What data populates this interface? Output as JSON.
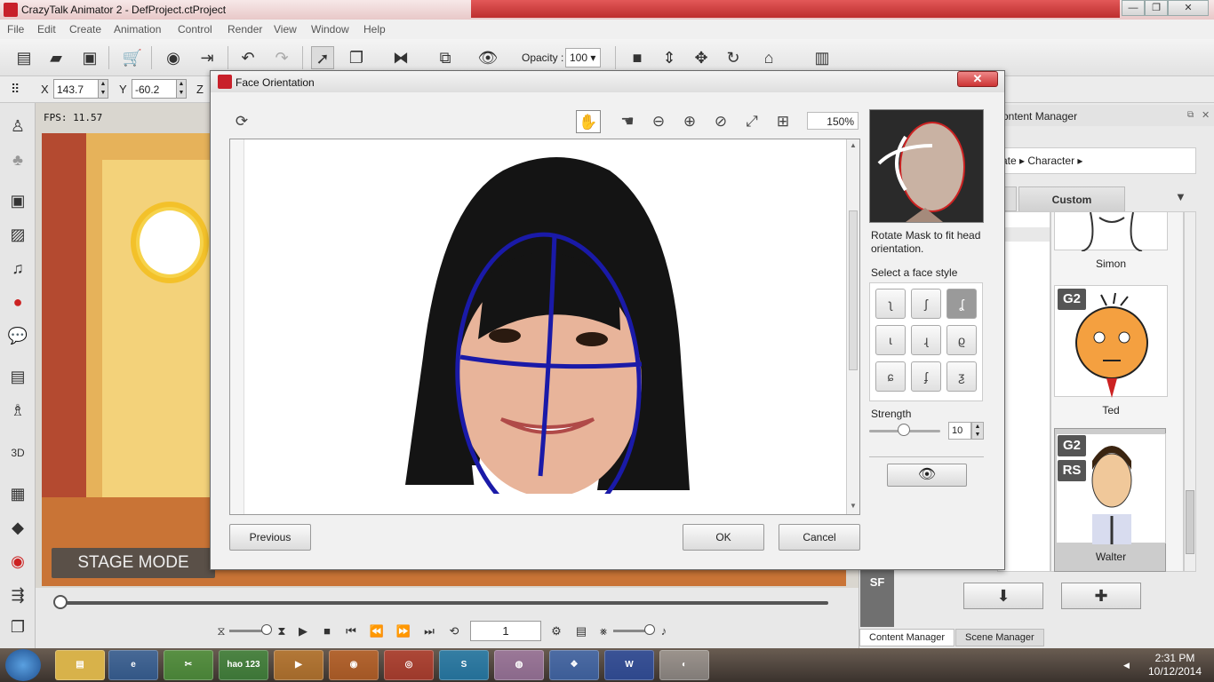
{
  "window": {
    "title": "CrazyTalk Animator 2  -  DefProject.ctProject",
    "min": "—",
    "max": "❐",
    "close": "✕"
  },
  "menu": [
    "File",
    "Edit",
    "Create",
    "Animation",
    "Control",
    "Render",
    "View",
    "Window",
    "Help"
  ],
  "toolbar": {
    "opacity_label": "Opacity :",
    "opacity_value": "100"
  },
  "transform": {
    "x_label": "X",
    "x_value": "143.7",
    "y_label": "Y",
    "y_value": "-60.2",
    "z_label": "Z"
  },
  "stage": {
    "fps": "FPS: 11.57",
    "mode_label": "STAGE MODE",
    "frame": "1"
  },
  "content_manager": {
    "title": "ontent Manager",
    "breadcrumb": "ate ▸ Character ▸",
    "tab_custom": "Custom",
    "items": [
      {
        "name": "Simon"
      },
      {
        "name": "Ted",
        "badge": "G2"
      },
      {
        "name": "Walter",
        "badge": "G2",
        "badge2": "RS"
      }
    ],
    "download_icon": "down-arrow-icon",
    "add_icon": "plus-icon",
    "tab_content": "Content Manager",
    "tab_scene": "Scene Manager",
    "sf_label": "SF"
  },
  "dialog": {
    "title": "Face Orientation",
    "close": "✕",
    "zoom": "150%",
    "hint": "Rotate Mask to fit head orientation.",
    "style_label": "Select a face style",
    "strength_label": "Strength",
    "strength_value": "10",
    "previous": "Previous",
    "ok": "OK",
    "cancel": "Cancel"
  },
  "taskbar": {
    "time": "2:31 PM",
    "date": "10/12/2014",
    "hao_label": "hao 123"
  },
  "colors": {
    "mask": "#1a1aa8",
    "title_red": "#c8202a"
  }
}
